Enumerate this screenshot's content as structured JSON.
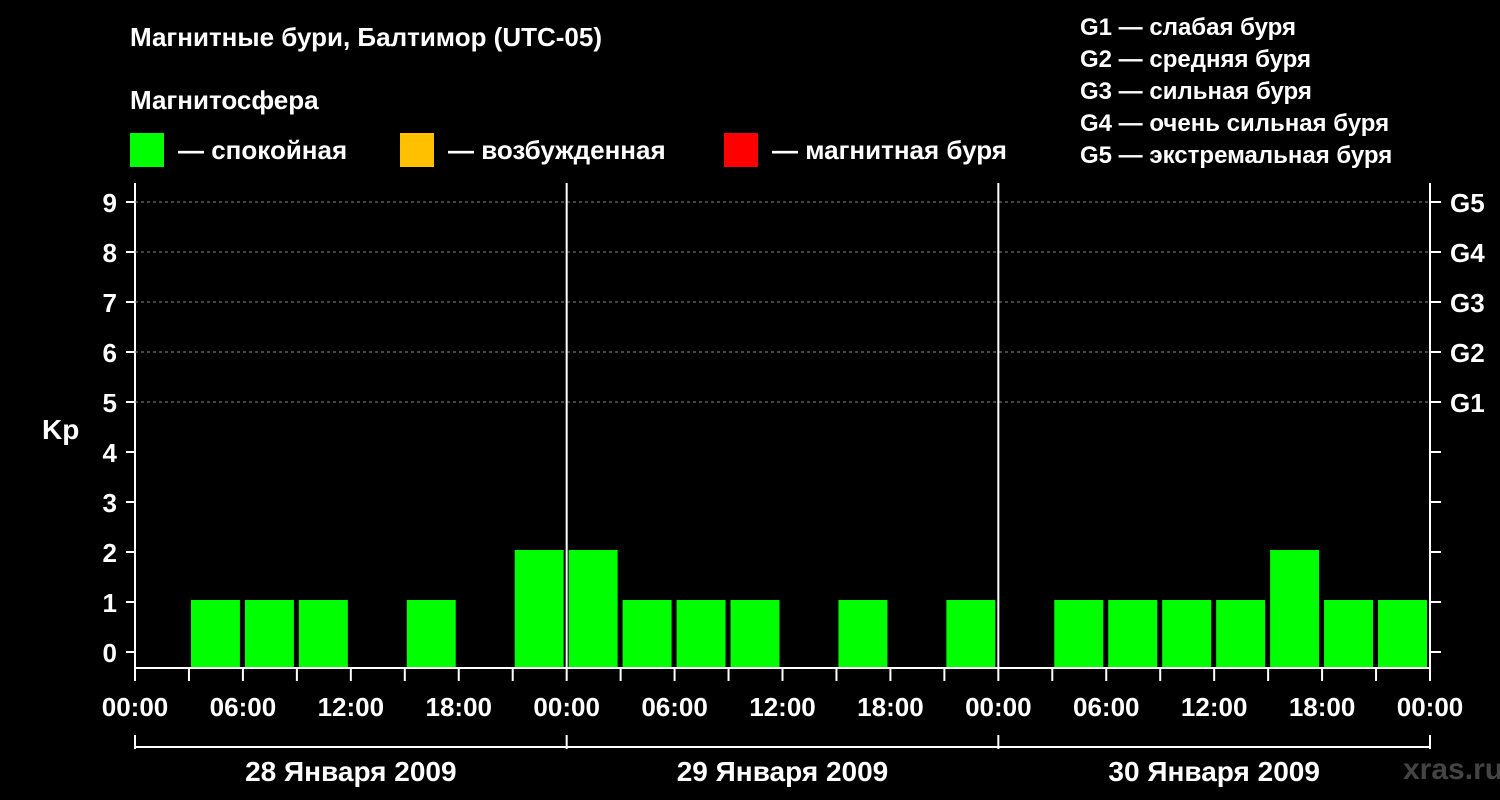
{
  "header": {
    "title": "Магнитные бури, Балтимор (UTC-05)",
    "subtitle": "Магнитосфера"
  },
  "legend": [
    {
      "label": "— спокойная",
      "color": "#00ff00"
    },
    {
      "label": "— возбужденная",
      "color": "#ffc000"
    },
    {
      "label": "— магнитная буря",
      "color": "#ff0000"
    }
  ],
  "storm_scale": [
    "G1 — слабая буря",
    "G2 — средняя буря",
    "G3 — сильная буря",
    "G4 — очень сильная буря",
    "G5 — экстремальная буря"
  ],
  "watermark": "xras.ru",
  "chart_data": {
    "type": "bar",
    "ylabel": "Kp",
    "ylim": [
      0,
      9
    ],
    "yticks": [
      0,
      1,
      2,
      3,
      4,
      5,
      6,
      7,
      8,
      9
    ],
    "right_ticks": [
      {
        "kp": 5,
        "label": "G1"
      },
      {
        "kp": 6,
        "label": "G2"
      },
      {
        "kp": 7,
        "label": "G3"
      },
      {
        "kp": 8,
        "label": "G4"
      },
      {
        "kp": 9,
        "label": "G5"
      }
    ],
    "grid": "dashed horizontal at Kp 5–9",
    "xtick_labels": [
      "00:00",
      "06:00",
      "12:00",
      "18:00",
      "00:00",
      "06:00",
      "12:00",
      "18:00",
      "00:00",
      "06:00",
      "12:00",
      "18:00",
      "00:00"
    ],
    "days": [
      "28 Января 2009",
      "29 Января 2009",
      "30 Января 2009"
    ],
    "bar_color": "#00ff00",
    "categories": [
      "28 Января 2009 00:00",
      "28 Января 2009 03:00",
      "28 Января 2009 06:00",
      "28 Января 2009 09:00",
      "28 Января 2009 12:00",
      "28 Января 2009 15:00",
      "28 Января 2009 18:00",
      "28 Января 2009 21:00",
      "29 Января 2009 00:00",
      "29 Января 2009 03:00",
      "29 Января 2009 06:00",
      "29 Января 2009 09:00",
      "29 Января 2009 12:00",
      "29 Января 2009 15:00",
      "29 Января 2009 18:00",
      "29 Января 2009 21:00",
      "30 Января 2009 00:00",
      "30 Января 2009 03:00",
      "30 Января 2009 06:00",
      "30 Января 2009 09:00",
      "30 Января 2009 12:00",
      "30 Января 2009 15:00",
      "30 Января 2009 18:00",
      "30 Января 2009 21:00"
    ],
    "values": [
      null,
      1,
      1,
      1,
      null,
      1,
      null,
      2,
      2,
      1,
      1,
      1,
      null,
      1,
      null,
      1,
      null,
      1,
      1,
      1,
      1,
      2,
      1,
      1
    ]
  }
}
